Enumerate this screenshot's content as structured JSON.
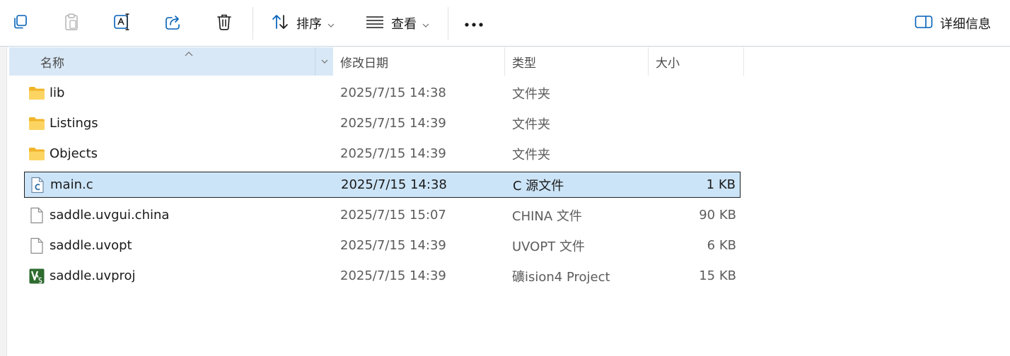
{
  "toolbar": {
    "copy_icon": "copy-icon",
    "paste_icon": "paste-icon",
    "rename_icon": "rename-icon",
    "share_icon": "share-icon",
    "delete_icon": "trash-icon",
    "sort_label": "排序",
    "view_label": "查看",
    "more_icon": "more-icon",
    "details_label": "详细信息"
  },
  "columns": {
    "name": "名称",
    "modified": "修改日期",
    "type": "类型",
    "size": "大小"
  },
  "files": [
    {
      "icon": "folder-icon",
      "name": "lib",
      "modified": "2025/7/15 14:38",
      "type": "文件夹",
      "size": ""
    },
    {
      "icon": "folder-icon",
      "name": "Listings",
      "modified": "2025/7/15 14:39",
      "type": "文件夹",
      "size": ""
    },
    {
      "icon": "folder-icon",
      "name": "Objects",
      "modified": "2025/7/15 14:39",
      "type": "文件夹",
      "size": ""
    },
    {
      "icon": "c-file-icon",
      "name": "main.c",
      "modified": "2025/7/15 14:38",
      "type": "C 源文件",
      "size": "1 KB",
      "selected": true
    },
    {
      "icon": "file-icon",
      "name": "saddle.uvgui.china",
      "modified": "2025/7/15 15:07",
      "type": "CHINA 文件",
      "size": "90 KB"
    },
    {
      "icon": "file-icon",
      "name": "saddle.uvopt",
      "modified": "2025/7/15 14:39",
      "type": "UVOPT 文件",
      "size": "6 KB"
    },
    {
      "icon": "uvproj-icon",
      "name": "saddle.uvproj",
      "modified": "2025/7/15 14:39",
      "type": "礦ision4 Project",
      "size": "15 KB"
    }
  ],
  "colors": {
    "accent": "#005fb8",
    "selection": "#cce4f7",
    "header_active": "#d9e8f6",
    "folder": "#f8c740"
  }
}
